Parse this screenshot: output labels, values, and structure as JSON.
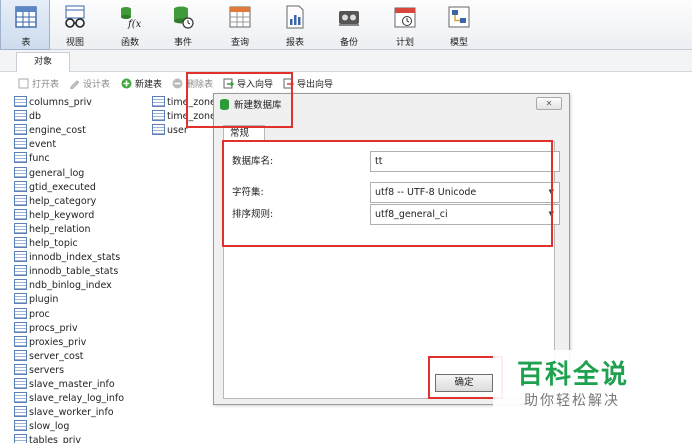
{
  "toolbar": {
    "items": [
      {
        "label": "表",
        "icon": "table-icon"
      },
      {
        "label": "视图",
        "icon": "view-glasses-icon"
      },
      {
        "label": "函数",
        "icon": "function-fx-icon"
      },
      {
        "label": "事件",
        "icon": "event-clock-icon"
      },
      {
        "label": "查询",
        "icon": "query-icon"
      },
      {
        "label": "报表",
        "icon": "report-icon"
      },
      {
        "label": "备份",
        "icon": "backup-icon"
      },
      {
        "label": "计划",
        "icon": "schedule-calendar-icon"
      },
      {
        "label": "模型",
        "icon": "model-icon"
      }
    ]
  },
  "object_tab": {
    "label": "对象"
  },
  "subtoolbar": {
    "open_table": "打开表",
    "design_table": "设计表",
    "new_table": "新建表",
    "delete_table": "删除表",
    "import_wizard": "导入向导",
    "export_wizard": "导出向导"
  },
  "tables_col1": [
    "columns_priv",
    "db",
    "engine_cost",
    "event",
    "func",
    "general_log",
    "gtid_executed",
    "help_category",
    "help_keyword",
    "help_relation",
    "help_topic",
    "innodb_index_stats",
    "innodb_table_stats",
    "ndb_binlog_index",
    "plugin",
    "proc",
    "procs_priv",
    "proxies_priv",
    "server_cost",
    "servers",
    "slave_master_info",
    "slave_relay_log_info",
    "slave_worker_info",
    "slow_log",
    "tables_priv"
  ],
  "tables_col2": [
    "time_zone",
    "time_zone",
    "user"
  ],
  "dialog": {
    "title": "新建数据库",
    "close_label": "✕",
    "tab_general": "常规",
    "db_name_label": "数据库名:",
    "db_name_value": "tt",
    "charset_label": "字符集:",
    "charset_value": "utf8 -- UTF-8 Unicode",
    "collation_label": "排序规则:",
    "collation_value": "utf8_general_ci",
    "ok_label": "确定"
  },
  "watermark": {
    "line1": "百科全说",
    "line2": "助你轻松解决"
  },
  "colors": {
    "highlight": "#e0312f",
    "watermark_green": "#20a150"
  }
}
